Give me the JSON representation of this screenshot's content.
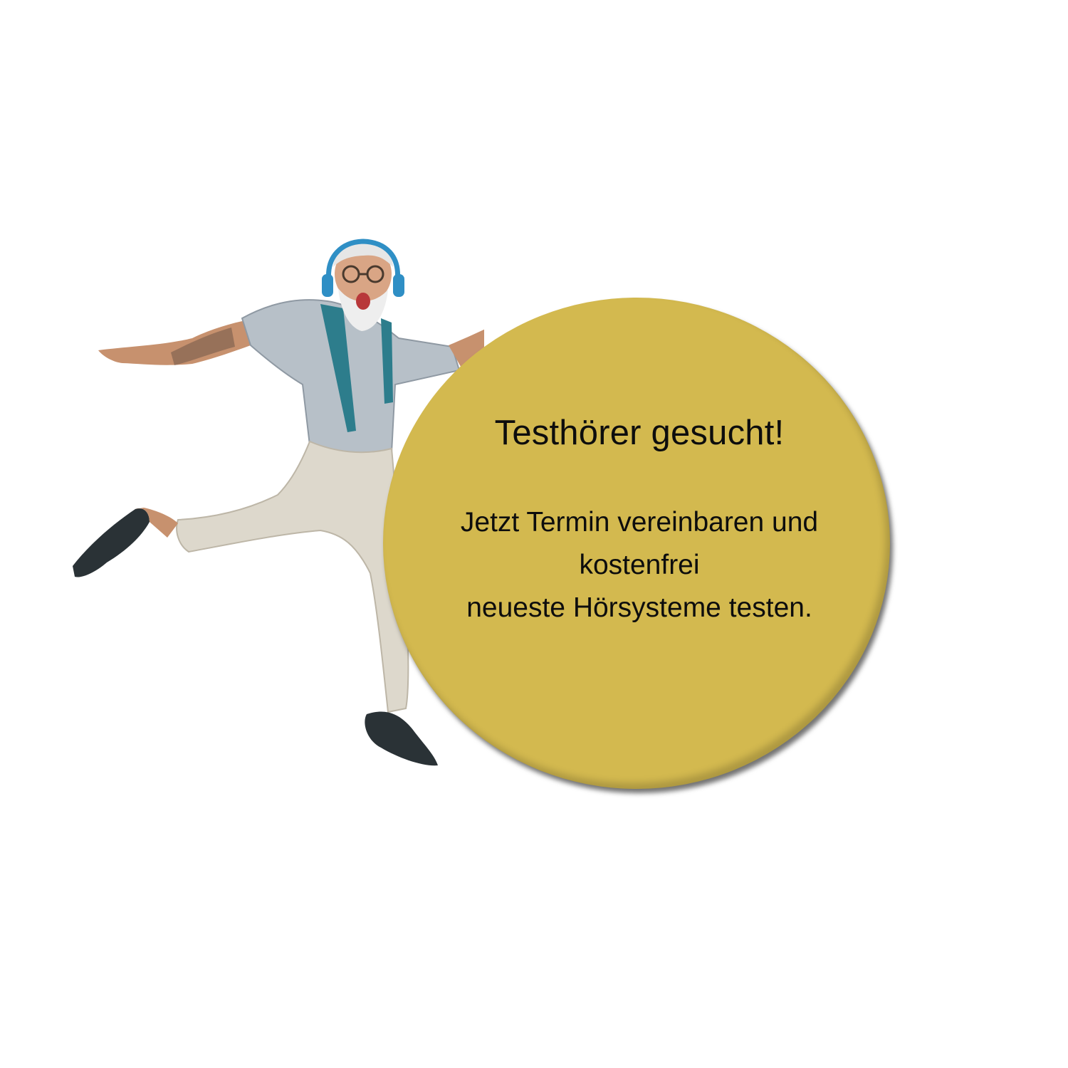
{
  "headline": "Testhörer gesucht!",
  "body_lines": [
    "Jetzt Termin vereinbaren und",
    "kostenfrei",
    "neueste Hörsysteme testen."
  ],
  "colors": {
    "circle": "#d3b94f",
    "text": "#0d0d0d",
    "background": "#ffffff"
  },
  "image": {
    "subject": "photo-cutout"
  }
}
